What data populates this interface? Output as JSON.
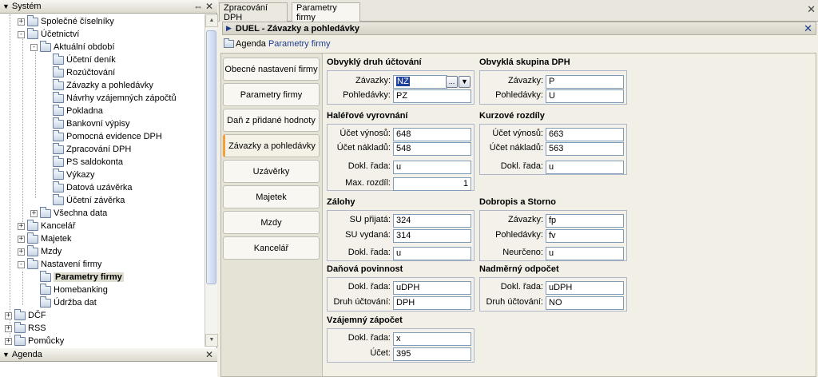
{
  "left_panel": {
    "system_title": "Systém",
    "agenda_title": "Agenda",
    "tree": [
      {
        "label": "Společné číselníky",
        "expander": "+"
      },
      {
        "label": "Účetnictví",
        "expander": "-"
      },
      {
        "label": "Aktuální období",
        "expander": "-"
      },
      {
        "label": "Účetní deník",
        "expander": ""
      },
      {
        "label": "Rozúčtování",
        "expander": ""
      },
      {
        "label": "Závazky a pohledávky",
        "expander": ""
      },
      {
        "label": "Návrhy vzájemných zápočtů",
        "expander": ""
      },
      {
        "label": "Pokladna",
        "expander": ""
      },
      {
        "label": "Bankovní výpisy",
        "expander": ""
      },
      {
        "label": "Pomocná evidence DPH",
        "expander": ""
      },
      {
        "label": "Zpracování DPH",
        "expander": ""
      },
      {
        "label": "PS saldokonta",
        "expander": ""
      },
      {
        "label": "Výkazy",
        "expander": ""
      },
      {
        "label": "Datová uzávěrka",
        "expander": ""
      },
      {
        "label": "Účetní závěrka",
        "expander": ""
      },
      {
        "label": "Všechna data",
        "expander": "+"
      },
      {
        "label": "Kancelář",
        "expander": "+"
      },
      {
        "label": "Majetek",
        "expander": "+"
      },
      {
        "label": "Mzdy",
        "expander": "+"
      },
      {
        "label": "Nastavení firmy",
        "expander": "-"
      },
      {
        "label": "Parametry firmy",
        "expander": ""
      },
      {
        "label": "Homebanking",
        "expander": ""
      },
      {
        "label": "Údržba dat",
        "expander": ""
      },
      {
        "label": "DČF",
        "expander": "+"
      },
      {
        "label": "RSS",
        "expander": "+"
      },
      {
        "label": "Pomůcky",
        "expander": "+"
      }
    ]
  },
  "tabs": [
    "Zpracování DPH",
    "Parametry firmy"
  ],
  "header": {
    "title": "DUEL - Závazky a pohledávky"
  },
  "breadcrumb": {
    "prefix": "Agenda",
    "link": "Parametry firmy"
  },
  "side_tabs": [
    "Obecné nastavení firmy",
    "Parametry firmy",
    "Daň z přidané hodnoty",
    "Závazky a pohledávky",
    "Uzávěrky",
    "Majetek",
    "Mzdy",
    "Kancelář"
  ],
  "sections": {
    "obvykly_druh": {
      "title": "Obvyklý druh účtování",
      "zavazky_label": "Závazky:",
      "zavazky_value": "NZ",
      "pohledavky_label": "Pohledávky:",
      "pohledavky_value": "PZ",
      "browse_label": "..."
    },
    "obvykla_skupina": {
      "title": "Obvyklá skupina DPH",
      "zavazky_label": "Závazky:",
      "zavazky_value": "P",
      "pohledavky_label": "Pohledávky:",
      "pohledavky_value": "U"
    },
    "halerove": {
      "title": "Haléřové vyrovnání",
      "vynosu_label": "Účet výnosů:",
      "vynosu_value": "648",
      "nakladu_label": "Účet nákladů:",
      "nakladu_value": "548",
      "rada_label": "Dokl. řada:",
      "rada_value": "u",
      "max_label": "Max. rozdíl:",
      "max_value": "1"
    },
    "kurzove": {
      "title": "Kurzové rozdíly",
      "vynosu_label": "Účet výnosů:",
      "vynosu_value": "663",
      "nakladu_label": "Účet nákladů:",
      "nakladu_value": "563",
      "rada_label": "Dokl. řada:",
      "rada_value": "u"
    },
    "zalohy": {
      "title": "Zálohy",
      "prijata_label": "SU přijatá:",
      "prijata_value": "324",
      "vydana_label": "SU vydaná:",
      "vydana_value": "314",
      "rada_label": "Dokl. řada:",
      "rada_value": "u"
    },
    "dobropis": {
      "title": "Dobropis a Storno",
      "zavazky_label": "Závazky:",
      "zavazky_value": "fp",
      "pohledavky_label": "Pohledávky:",
      "pohledavky_value": "fv",
      "neurceno_label": "Neurčeno:",
      "neurceno_value": "u"
    },
    "danova": {
      "title": "Daňová povinnost",
      "rada_label": "Dokl. řada:",
      "rada_value": "uDPH",
      "druh_label": "Druh účtování:",
      "druh_value": "DPH"
    },
    "nadmerny": {
      "title": "Nadměrný odpočet",
      "rada_label": "Dokl. řada:",
      "rada_value": "uDPH",
      "druh_label": "Druh účtování:",
      "druh_value": "NO"
    },
    "vzajemny": {
      "title": "Vzájemný zápočet",
      "rada_label": "Dokl. řada:",
      "rada_value": "x",
      "ucet_label": "Účet:",
      "ucet_value": "395"
    }
  }
}
